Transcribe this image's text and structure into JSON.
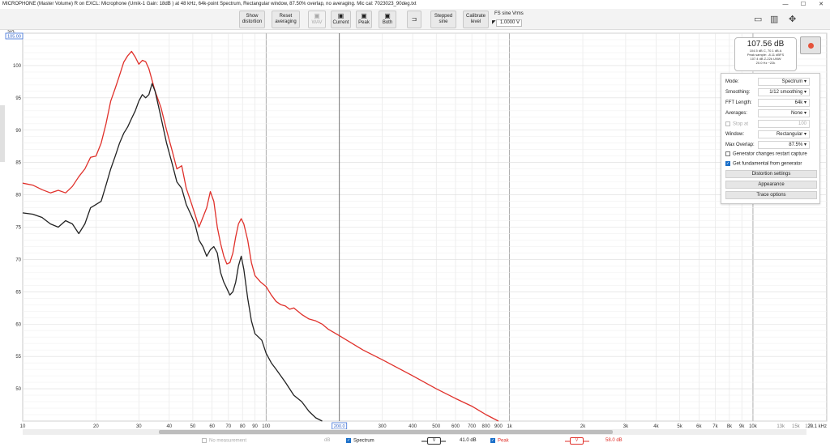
{
  "window": {
    "title": "MICROPHONE (Master Volume) R on EXCL: Microphone (Umik-1  Gain: 18dB  ) at 48 kHz, 64k-point Spectrum, Rectangular window, 87.50% overlap, no averaging. Mic cal: 7023023_90deg.txt",
    "controls": {
      "minimize": "—",
      "maximize": "☐",
      "close": "✕"
    }
  },
  "toolbar": {
    "show_distortion": [
      "Show",
      "distortion"
    ],
    "reset_averaging": [
      "Reset",
      "averaging"
    ],
    "wav": "WAV",
    "current": "Current",
    "peak": "Peak",
    "both": "Both",
    "stepped_sine": [
      "Stepped",
      "sine"
    ],
    "calibrate_level": [
      "Calibrate",
      "level"
    ],
    "fs_sine_label": "FS sine Vrms",
    "fs_sine_value": "1.0000 V"
  },
  "readout": {
    "level": "107.56 dB",
    "lines": [
      "104.5 dB C, 70.1 dB A",
      "Peak sample: -8.11 dBFS",
      "107.4 dB Z-22k UNW",
      "20.0 Hz ~22k"
    ]
  },
  "panel": {
    "rows": [
      {
        "label": "Mode:",
        "value": "Spectrum"
      },
      {
        "label": "Smoothing:",
        "value": "1/12 smoothing"
      },
      {
        "label": "FFT Length:",
        "value": "64k"
      },
      {
        "label": "Averages:",
        "value": "None"
      },
      {
        "label": "Stop at",
        "value": "100"
      },
      {
        "label": "Window:",
        "value": "Rectangular"
      },
      {
        "label": "Max Overlap:",
        "value": "87.5%"
      }
    ],
    "check_restart": "Generator changes restart capture",
    "check_fundamental": "Get fundamental from generator",
    "btn_distortion": "Distortion settings",
    "btn_appearance": "Appearance",
    "btn_trace": "Trace options"
  },
  "legend": {
    "no_measurement": "No measurement",
    "no_measurement_unit": "dB",
    "spectrum": "Spectrum",
    "spectrum_value": "41.0 dB",
    "peak": "Peak",
    "peak_value": "58.0 dB",
    "vbadge": "V"
  },
  "axes": {
    "y_unit": "SPL",
    "y_top_box": "105.00",
    "cursor_freq": "200.0",
    "x_unit": "20.1 kHz"
  },
  "chart_data": {
    "type": "line",
    "x_scale": "log",
    "xlim": [
      10,
      20100
    ],
    "ylim": [
      45,
      105
    ],
    "y_ticks": [
      50,
      55,
      60,
      65,
      70,
      75,
      80,
      85,
      90,
      95,
      100
    ],
    "x_ticks": [
      {
        "v": 10,
        "l": "10"
      },
      {
        "v": 20,
        "l": "20"
      },
      {
        "v": 30,
        "l": "30"
      },
      {
        "v": 40,
        "l": "40"
      },
      {
        "v": 50,
        "l": "50"
      },
      {
        "v": 60,
        "l": "60"
      },
      {
        "v": 70,
        "l": "70"
      },
      {
        "v": 80,
        "l": "80"
      },
      {
        "v": 90,
        "l": "90"
      },
      {
        "v": 100,
        "l": "100"
      },
      {
        "v": 300,
        "l": "300"
      },
      {
        "v": 400,
        "l": "400"
      },
      {
        "v": 500,
        "l": "500"
      },
      {
        "v": 600,
        "l": "600"
      },
      {
        "v": 700,
        "l": "700"
      },
      {
        "v": 800,
        "l": "800"
      },
      {
        "v": 900,
        "l": "900"
      },
      {
        "v": 1000,
        "l": "1k"
      },
      {
        "v": 2000,
        "l": "2k"
      },
      {
        "v": 3000,
        "l": "3k"
      },
      {
        "v": 4000,
        "l": "4k"
      },
      {
        "v": 5000,
        "l": "5k"
      },
      {
        "v": 6000,
        "l": "6k"
      },
      {
        "v": 7000,
        "l": "7k"
      },
      {
        "v": 8000,
        "l": "8k"
      },
      {
        "v": 9000,
        "l": "9k"
      },
      {
        "v": 10000,
        "l": "10k"
      },
      {
        "v": 13000,
        "l": "13k"
      },
      {
        "v": 15000,
        "l": "15k"
      },
      {
        "v": 17000,
        "l": "17k"
      }
    ],
    "cursor_x": 200,
    "series": [
      {
        "name": "Peak",
        "color": "#e0312b",
        "points": [
          [
            10,
            81.8
          ],
          [
            11,
            81.5
          ],
          [
            12,
            80.8
          ],
          [
            13,
            80.3
          ],
          [
            14,
            80.7
          ],
          [
            15,
            80.3
          ],
          [
            16,
            81.3
          ],
          [
            17,
            82.8
          ],
          [
            18,
            84
          ],
          [
            19,
            85.8
          ],
          [
            20,
            86
          ],
          [
            21,
            88
          ],
          [
            22,
            91
          ],
          [
            23,
            94.5
          ],
          [
            24,
            96.5
          ],
          [
            25,
            98.5
          ],
          [
            26,
            100.5
          ],
          [
            27,
            101.5
          ],
          [
            28,
            102.2
          ],
          [
            29,
            101.3
          ],
          [
            30,
            100.2
          ],
          [
            31,
            100.8
          ],
          [
            32,
            100.6
          ],
          [
            33,
            99.5
          ],
          [
            35,
            96
          ],
          [
            37,
            93.5
          ],
          [
            39,
            90
          ],
          [
            41,
            87
          ],
          [
            43,
            84
          ],
          [
            45,
            84.5
          ],
          [
            47,
            81
          ],
          [
            49,
            79
          ],
          [
            51,
            77
          ],
          [
            53,
            75
          ],
          [
            55,
            76.5
          ],
          [
            57,
            78
          ],
          [
            59,
            80.5
          ],
          [
            61,
            79
          ],
          [
            63,
            75
          ],
          [
            65,
            72.5
          ],
          [
            67,
            70.5
          ],
          [
            69,
            69.3
          ],
          [
            71,
            69.5
          ],
          [
            73,
            71
          ],
          [
            75,
            73.5
          ],
          [
            77,
            75.5
          ],
          [
            79,
            76.3
          ],
          [
            81,
            75.5
          ],
          [
            84,
            73
          ],
          [
            87,
            69.5
          ],
          [
            90,
            67.5
          ],
          [
            95,
            66.5
          ],
          [
            100,
            65.8
          ],
          [
            105,
            64.5
          ],
          [
            110,
            63.5
          ],
          [
            115,
            63
          ],
          [
            120,
            62.8
          ],
          [
            125,
            62.3
          ],
          [
            130,
            62.5
          ],
          [
            140,
            61.5
          ],
          [
            150,
            60.8
          ],
          [
            160,
            60.5
          ],
          [
            170,
            60
          ],
          [
            180,
            59.2
          ],
          [
            200,
            58.2
          ],
          [
            250,
            56
          ],
          [
            300,
            54.5
          ],
          [
            400,
            52
          ],
          [
            500,
            50
          ],
          [
            600,
            48.5
          ],
          [
            700,
            47.3
          ],
          [
            800,
            46
          ],
          [
            900,
            45
          ]
        ]
      },
      {
        "name": "Spectrum",
        "color": "#222222",
        "points": [
          [
            10,
            77.2
          ],
          [
            11,
            77
          ],
          [
            12,
            76.5
          ],
          [
            13,
            75.5
          ],
          [
            14,
            75
          ],
          [
            15,
            76
          ],
          [
            16,
            75.5
          ],
          [
            17,
            74
          ],
          [
            18,
            75.5
          ],
          [
            19,
            78
          ],
          [
            20,
            78.5
          ],
          [
            21,
            79
          ],
          [
            22,
            81.5
          ],
          [
            23,
            84
          ],
          [
            24,
            86
          ],
          [
            25,
            88
          ],
          [
            26,
            89.5
          ],
          [
            27,
            90.5
          ],
          [
            28,
            91.8
          ],
          [
            29,
            93
          ],
          [
            30,
            94.5
          ],
          [
            31,
            95.5
          ],
          [
            32,
            95
          ],
          [
            33,
            95.5
          ],
          [
            34,
            97.2
          ],
          [
            35,
            96
          ],
          [
            37,
            92
          ],
          [
            39,
            88
          ],
          [
            41,
            85
          ],
          [
            43,
            82
          ],
          [
            45,
            81
          ],
          [
            47,
            78.5
          ],
          [
            49,
            77
          ],
          [
            51,
            75.5
          ],
          [
            53,
            73
          ],
          [
            55,
            72
          ],
          [
            57,
            70.5
          ],
          [
            59,
            71.5
          ],
          [
            61,
            72
          ],
          [
            63,
            71
          ],
          [
            65,
            68
          ],
          [
            67,
            66.5
          ],
          [
            69,
            65.5
          ],
          [
            71,
            64.5
          ],
          [
            73,
            65
          ],
          [
            75,
            66.5
          ],
          [
            77,
            69
          ],
          [
            79,
            70.5
          ],
          [
            81,
            68.5
          ],
          [
            84,
            64
          ],
          [
            87,
            60.5
          ],
          [
            90,
            58.5
          ],
          [
            93,
            58
          ],
          [
            96,
            57.5
          ],
          [
            100,
            55.5
          ],
          [
            105,
            54
          ],
          [
            110,
            53
          ],
          [
            120,
            51
          ],
          [
            130,
            49
          ],
          [
            140,
            48
          ],
          [
            150,
            46.5
          ],
          [
            160,
            45.5
          ],
          [
            170,
            45
          ]
        ]
      }
    ]
  }
}
